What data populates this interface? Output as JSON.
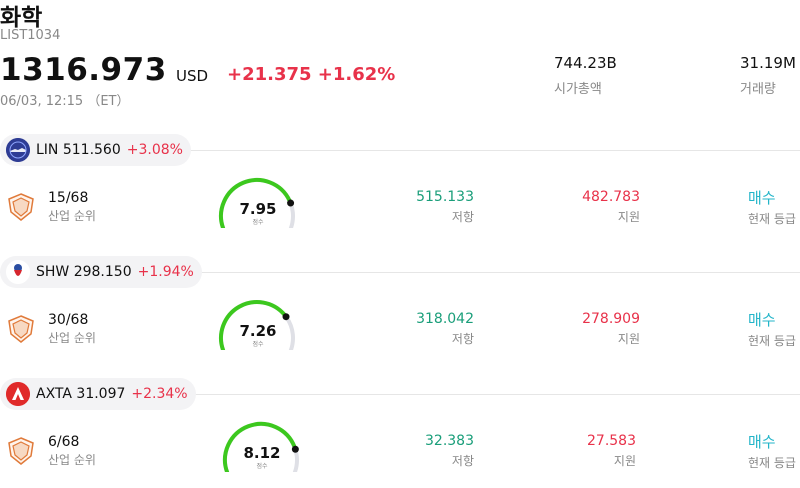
{
  "header": {
    "title": "화학",
    "ticker": "LIST1034",
    "price": "1316.973",
    "currency": "USD",
    "change": "+21.375 +1.62%",
    "timestamp": "06/03, 12:15 （ET）"
  },
  "stats": {
    "market_cap_value": "744.23B",
    "market_cap_label": "시가총액",
    "volume_value": "31.19M",
    "volume_label": "거래량"
  },
  "colors": {
    "up": "#e8324a",
    "resistance": "#1a9e7a",
    "signal": "#23b5c9",
    "gauge_fill": "#3cc81e"
  },
  "stocks": [
    {
      "symbol": "LIN 511.560",
      "change_pct": "+3.08%",
      "logo_icon": "lin-logo-icon",
      "rank": "15/68",
      "rank_label": "산업 순위",
      "score": "7.95",
      "score_value": 7.95,
      "score_label": "점수",
      "resistance": "515.133",
      "resistance_label": "저항",
      "support": "482.783",
      "support_label": "지원",
      "signal": "매수",
      "signal_label": "현재 등급"
    },
    {
      "symbol": "SHW 298.150",
      "change_pct": "+1.94%",
      "logo_icon": "shw-logo-icon",
      "rank": "30/68",
      "rank_label": "산업 순위",
      "score": "7.26",
      "score_value": 7.26,
      "score_label": "점수",
      "resistance": "318.042",
      "resistance_label": "저항",
      "support": "278.909",
      "support_label": "지원",
      "signal": "매수",
      "signal_label": "현재 등급"
    },
    {
      "symbol": "AXTA 31.097",
      "change_pct": "+2.34%",
      "logo_icon": "axta-logo-icon",
      "rank": "6/68",
      "rank_label": "산업 순위",
      "score": "8.12",
      "score_value": 8.12,
      "score_label": "점수",
      "resistance": "32.383",
      "resistance_label": "저항",
      "support": "27.583",
      "support_label": "지원",
      "signal": "매수",
      "signal_label": "현재 등급"
    }
  ]
}
